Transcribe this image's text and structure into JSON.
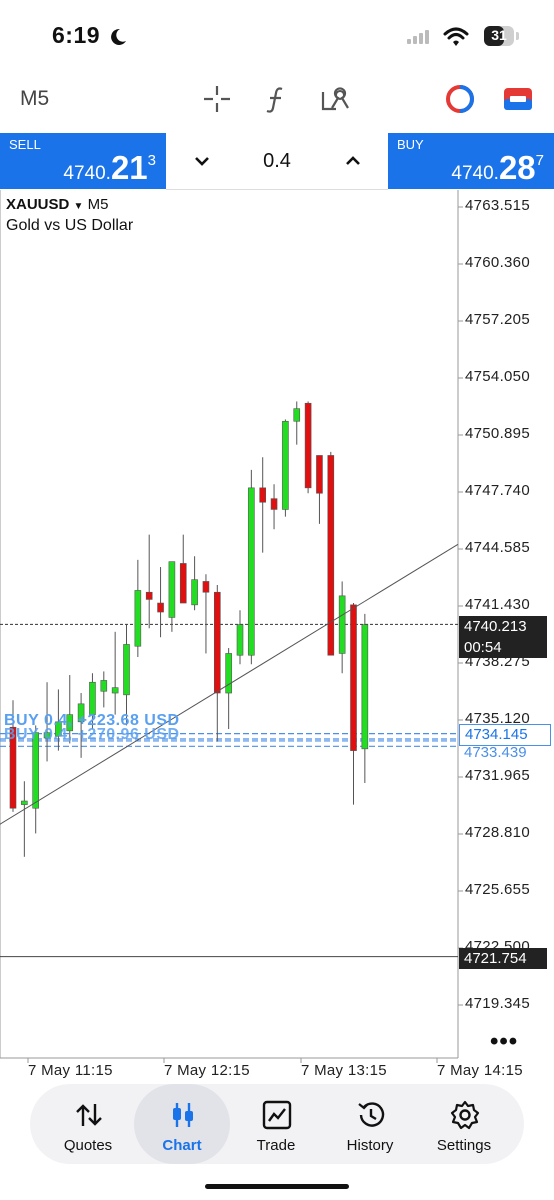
{
  "status_bar": {
    "time": "6:19",
    "battery": "31"
  },
  "toolbar": {
    "timeframe": "M5",
    "icons": [
      "crosshair-icon",
      "function-icon",
      "objects-icon",
      "one-click-trading-icon",
      "trade-levels-icon"
    ]
  },
  "trade_bar": {
    "sell": {
      "label": "SELL",
      "price_main": "4740.",
      "price_big": "21",
      "price_sup": "3"
    },
    "buy": {
      "label": "BUY",
      "price_main": "4740.",
      "price_big": "28",
      "price_sup": "7"
    },
    "lot": "0.4"
  },
  "chart": {
    "symbol": "XAUUSD",
    "timeframe": "M5",
    "description": "Gold vs US Dollar",
    "price_labels": [
      "4763.515",
      "4760.360",
      "4757.205",
      "4754.050",
      "4750.895",
      "4747.740",
      "4744.585",
      "4741.430",
      "4738.275",
      "4735.120",
      "4731.965",
      "4728.810",
      "4725.655",
      "4722.500",
      "4719.345"
    ],
    "time_labels": [
      "7 May 11:15",
      "7 May 12:15",
      "7 May 13:15",
      "7 May 14:15"
    ],
    "bid_tag": "4740.213",
    "countdown": "00:54",
    "order_tag": "4734.145",
    "order_tag_2": "4733.439",
    "hline_tag": "4721.754",
    "position_labels": [
      "BUY 0.4, +223.68 USD",
      "BUY 0.4, +270.96 USD"
    ],
    "colors": {
      "bull": "#22dd22",
      "bear": "#e01010",
      "accent": "#1a73e8",
      "order_line": "#4a8fe8"
    }
  },
  "chart_data": {
    "type": "candlestick",
    "symbol": "XAUUSD",
    "timeframe": "M5",
    "ylim": [
      4718.0,
      4765.5
    ],
    "candles": [
      {
        "o": 4734.5,
        "h": 4736.0,
        "l": 4729.8,
        "c": 4730.0
      },
      {
        "o": 4730.2,
        "h": 4731.5,
        "l": 4727.3,
        "c": 4730.4
      },
      {
        "o": 4730.0,
        "h": 4734.6,
        "l": 4728.6,
        "c": 4734.2
      },
      {
        "o": 4733.9,
        "h": 4737.0,
        "l": 4732.6,
        "c": 4734.2
      },
      {
        "o": 4734.0,
        "h": 4736.6,
        "l": 4733.2,
        "c": 4734.8
      },
      {
        "o": 4734.3,
        "h": 4737.4,
        "l": 4733.6,
        "c": 4735.2
      },
      {
        "o": 4734.8,
        "h": 4736.4,
        "l": 4732.8,
        "c": 4735.8
      },
      {
        "o": 4735.2,
        "h": 4737.5,
        "l": 4734.4,
        "c": 4737.0
      },
      {
        "o": 4736.5,
        "h": 4737.6,
        "l": 4735.6,
        "c": 4737.1
      },
      {
        "o": 4736.4,
        "h": 4739.8,
        "l": 4735.2,
        "c": 4736.7
      },
      {
        "o": 4736.3,
        "h": 4740.2,
        "l": 4734.6,
        "c": 4739.1
      },
      {
        "o": 4739.0,
        "h": 4743.8,
        "l": 4738.4,
        "c": 4742.1
      },
      {
        "o": 4742.0,
        "h": 4745.2,
        "l": 4740.0,
        "c": 4741.6
      },
      {
        "o": 4741.4,
        "h": 4743.4,
        "l": 4739.5,
        "c": 4740.9
      },
      {
        "o": 4740.6,
        "h": 4743.6,
        "l": 4739.8,
        "c": 4743.7
      },
      {
        "o": 4743.6,
        "h": 4745.2,
        "l": 4741.4,
        "c": 4741.4
      },
      {
        "o": 4741.3,
        "h": 4744.0,
        "l": 4741.0,
        "c": 4742.7
      },
      {
        "o": 4742.6,
        "h": 4743.0,
        "l": 4738.6,
        "c": 4742.0
      },
      {
        "o": 4742.0,
        "h": 4742.4,
        "l": 4733.7,
        "c": 4736.4
      },
      {
        "o": 4736.4,
        "h": 4738.9,
        "l": 4734.4,
        "c": 4738.6
      },
      {
        "o": 4738.5,
        "h": 4741.0,
        "l": 4738.0,
        "c": 4740.2
      },
      {
        "o": 4738.5,
        "h": 4748.8,
        "l": 4738.0,
        "c": 4747.8
      },
      {
        "o": 4747.8,
        "h": 4749.5,
        "l": 4744.2,
        "c": 4747.0
      },
      {
        "o": 4747.2,
        "h": 4748.0,
        "l": 4745.5,
        "c": 4746.6
      },
      {
        "o": 4746.6,
        "h": 4751.6,
        "l": 4746.2,
        "c": 4751.5
      },
      {
        "o": 4751.5,
        "h": 4752.6,
        "l": 4750.2,
        "c": 4752.2
      },
      {
        "o": 4752.5,
        "h": 4752.6,
        "l": 4747.5,
        "c": 4747.8
      },
      {
        "o": 4749.6,
        "h": 4749.6,
        "l": 4745.8,
        "c": 4747.5
      },
      {
        "o": 4749.6,
        "h": 4749.8,
        "l": 4738.5,
        "c": 4738.5
      },
      {
        "o": 4738.6,
        "h": 4742.6,
        "l": 4737.5,
        "c": 4741.8
      },
      {
        "o": 4741.3,
        "h": 4741.4,
        "l": 4730.2,
        "c": 4733.2
      },
      {
        "o": 4733.3,
        "h": 4740.8,
        "l": 4731.4,
        "c": 4740.2
      }
    ],
    "bid": 4740.213,
    "horizontal_line": 4721.754,
    "order_lines": [
      4734.145,
      4733.439
    ],
    "trendline": [
      [
        0,
        4729.3
      ],
      [
        31,
        4741.5
      ]
    ]
  }
}
